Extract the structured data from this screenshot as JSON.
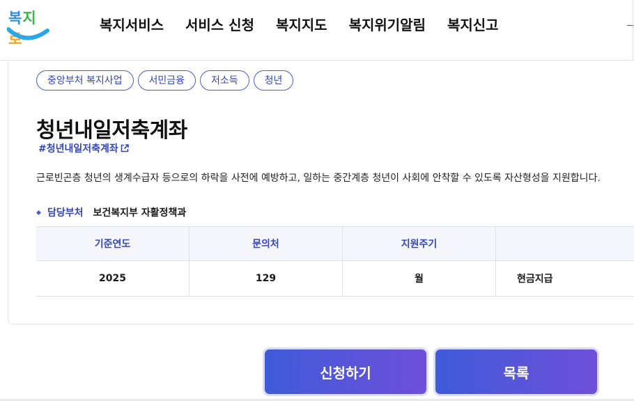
{
  "logo": {
    "text_1": "복",
    "text_2": "지",
    "text_3": "로"
  },
  "nav": [
    "복지서비스",
    "서비스 신청",
    "복지지도",
    "복지위기알림",
    "복지신고"
  ],
  "tags": [
    "중앙부처 복지사업",
    "서민금융",
    "저소득",
    "청년"
  ],
  "service": {
    "title": "청년내일저축계좌",
    "hashtag": "#청년내일저축계좌",
    "description": "근로빈곤층 청년의 생계수급자 등으로의 하락을 사전에 예방하고, 일하는 중간계층 청년이 사회에 안착할 수 있도록 자산형성을 지원합니다.",
    "dept_label": "담당부처",
    "dept_value": "보건복지부 자활정책과"
  },
  "table": {
    "headers": [
      "기준연도",
      "문의처",
      "지원주기",
      ""
    ],
    "values": [
      "2025",
      "129",
      "월",
      "현금지급"
    ]
  },
  "buttons": {
    "apply": "신청하기",
    "list": "목록"
  },
  "colors": {
    "accent": "#3347b8",
    "button_start": "#3f5bd9",
    "button_end": "#6e4fd9"
  },
  "icons": {
    "external_link": "external-link-icon",
    "bullet": "diamond-bullet-icon"
  }
}
